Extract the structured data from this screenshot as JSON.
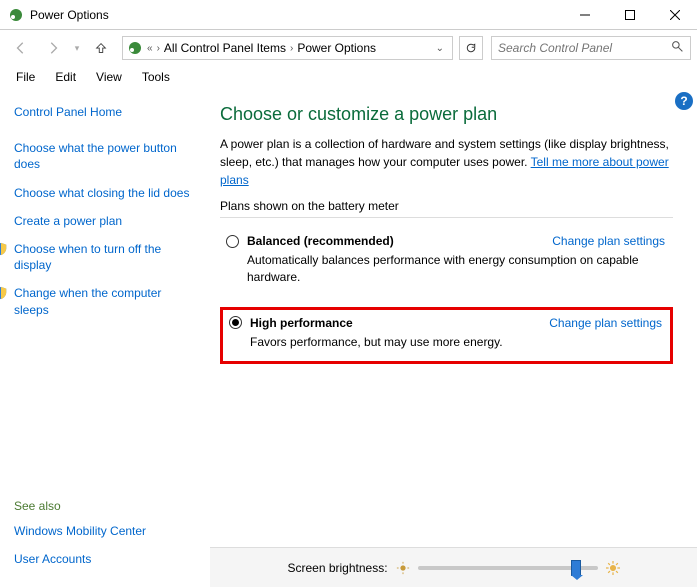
{
  "window": {
    "title": "Power Options"
  },
  "breadcrumb": {
    "item1": "All Control Panel Items",
    "item2": "Power Options"
  },
  "search": {
    "placeholder": "Search Control Panel"
  },
  "menu": {
    "file": "File",
    "edit": "Edit",
    "view": "View",
    "tools": "Tools"
  },
  "sidebar": {
    "home": "Control Panel Home",
    "links": [
      "Choose what the power button does",
      "Choose what closing the lid does",
      "Create a power plan",
      "Choose when to turn off the display",
      "Change when the computer sleeps"
    ],
    "see_also_label": "See also",
    "see_also": [
      "Windows Mobility Center",
      "User Accounts"
    ]
  },
  "main": {
    "heading": "Choose or customize a power plan",
    "desc": "A power plan is a collection of hardware and system settings (like display brightness, sleep, etc.) that manages how your computer uses power. ",
    "more_link": "Tell me more about power plans",
    "subheading": "Plans shown on the battery meter",
    "change_plan": "Change plan settings",
    "plans": [
      {
        "name": "Balanced (recommended)",
        "desc": "Automatically balances performance with energy consumption on capable hardware.",
        "checked": false
      },
      {
        "name": "High performance",
        "desc": "Favors performance, but may use more energy.",
        "checked": true
      }
    ],
    "brightness_label": "Screen brightness:"
  }
}
